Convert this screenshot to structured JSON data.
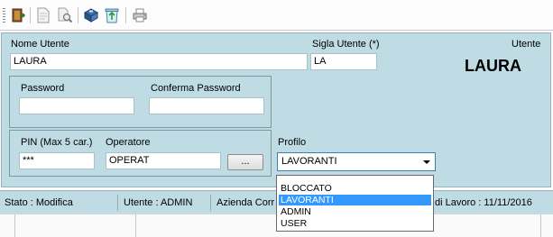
{
  "toolbar": {
    "buttons": [
      {
        "icon": "exit-icon"
      },
      {
        "icon": "document-icon"
      },
      {
        "icon": "search-icon"
      },
      {
        "icon": "save-icon"
      },
      {
        "icon": "recycle-icon"
      },
      {
        "icon": "print-icon"
      }
    ]
  },
  "form": {
    "nome_utente_label": "Nome Utente",
    "nome_utente_value": "LAURA",
    "sigla_label": "Sigla Utente (*)",
    "sigla_value": "LA",
    "utente_label": "Utente",
    "utente_display": "LAURA",
    "password_label": "Password",
    "password_value": "",
    "conferma_password_label": "Conferma Password",
    "conferma_password_value": "",
    "pin_label": "PIN (Max 5 car.)",
    "pin_value": "***",
    "operatore_label": "Operatore",
    "operatore_value": "OPERAT",
    "browse_label": "...",
    "profilo_label": "Profilo",
    "profilo_value": "LAVORANTI",
    "profilo_options": [
      "BLOCCATO",
      "LAVORANTI",
      "ADMIN",
      "USER"
    ],
    "profilo_selected_index": 1
  },
  "status": {
    "stato": "Stato : Modifica",
    "utente": "Utente : ADMIN",
    "azienda": "Azienda Corr",
    "data_lavoro": "di Lavoro : 11/11/2016"
  },
  "colors": {
    "panel_bg": "#bfdbe3",
    "selection": "#3399ff",
    "combo_border": "#3c7fb1"
  }
}
